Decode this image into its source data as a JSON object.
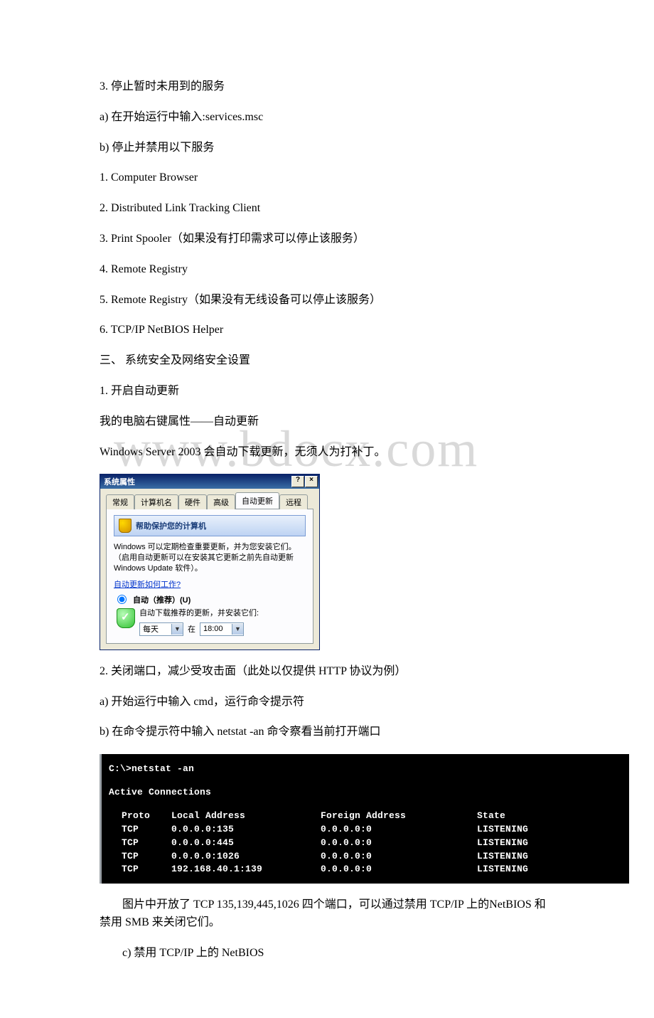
{
  "watermark": "www.bdocx.com",
  "body": {
    "l1": "3. 停止暂时未用到的服务",
    "l2": "a) 在开始运行中输入:services.msc",
    "l3": "b) 停止并禁用以下服务",
    "l4": "1. Computer Browser",
    "l5": "2. Distributed Link Tracking Client",
    "l6": "3. Print Spooler（如果没有打印需求可以停止该服务）",
    "l7": "4. Remote Registry",
    "l8": "5. Remote Registry（如果没有无线设备可以停止该服务）",
    "l9": "6. TCP/IP NetBIOS Helper",
    "l10": "三、 系统安全及网络安全设置",
    "l11": "1. 开启自动更新",
    "l12": "我的电脑右键属性——自动更新",
    "l13": "Windows Server 2003 会自动下载更新，无须人为打补丁。",
    "l14": "2. 关闭端口，减少受攻击面（此处以仅提供 HTTP 协议为例）",
    "l15": "a) 开始运行中输入 cmd，运行命令提示符",
    "l16": "b) 在命令提示符中输入 netstat -an 命令察看当前打开端口",
    "l17": "　　图片中开放了 TCP 135,139,445,1026 四个端口，可以通过禁用 TCP/IP 上的NetBIOS 和禁用 SMB 来关闭它们。",
    "l18": "　　c) 禁用 TCP/IP 上的 NetBIOS"
  },
  "dialog": {
    "title": "系统属性",
    "help": "?",
    "close": "×",
    "tabs": {
      "t1": "常规",
      "t2": "计算机名",
      "t3": "硬件",
      "t4": "高级",
      "t5": "自动更新",
      "t6": "远程"
    },
    "info": "帮助保护您的计算机",
    "desc": "Windows 可以定期检查重要更新，并为您安装它们。（启用自动更新可以在安装其它更新之前先自动更新 Windows Update 软件）。",
    "link": "自动更新如何工作?",
    "opt_label": "自动（推荐）(U)",
    "opt_sub": "自动下载推荐的更新，并安装它们:",
    "freq": "每天",
    "at": "在",
    "time": "18:00"
  },
  "cmd": {
    "prompt": "C:\\>netstat -an",
    "title": "Active Connections",
    "hdr": {
      "proto": "Proto",
      "local": "Local Address",
      "foreign": "Foreign Address",
      "state": "State"
    },
    "rows": [
      {
        "proto": "TCP",
        "local": "0.0.0.0:135",
        "foreign": "0.0.0.0:0",
        "state": "LISTENING"
      },
      {
        "proto": "TCP",
        "local": "0.0.0.0:445",
        "foreign": "0.0.0.0:0",
        "state": "LISTENING"
      },
      {
        "proto": "TCP",
        "local": "0.0.0.0:1026",
        "foreign": "0.0.0.0:0",
        "state": "LISTENING"
      },
      {
        "proto": "TCP",
        "local": "192.168.40.1:139",
        "foreign": "0.0.0.0:0",
        "state": "LISTENING"
      }
    ]
  }
}
